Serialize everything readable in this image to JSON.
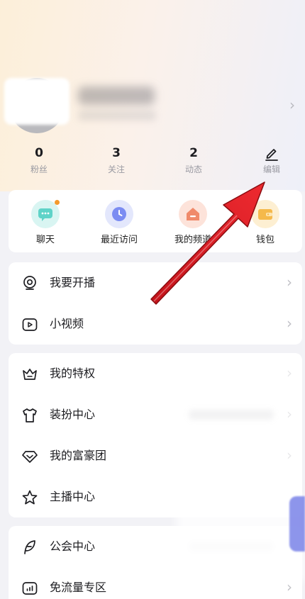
{
  "profile": {
    "stats": [
      {
        "value": "0",
        "label": "粉丝"
      },
      {
        "value": "3",
        "label": "关注"
      },
      {
        "value": "2",
        "label": "动态"
      }
    ],
    "edit_label": "编辑"
  },
  "quick_actions": [
    {
      "label": "聊天",
      "icon": "chat-icon",
      "color": "#5fd3c8"
    },
    {
      "label": "最近访问",
      "icon": "clock-icon",
      "color": "#7b8cf2"
    },
    {
      "label": "我的频道",
      "icon": "home-icon",
      "color": "#f08a6a"
    },
    {
      "label": "钱包",
      "icon": "wallet-icon",
      "color": "#f5b94b"
    }
  ],
  "menu_sections": [
    {
      "items": [
        "我要开播",
        "小视频"
      ]
    },
    {
      "items": [
        "我的特权",
        "装扮中心",
        "我的富豪团",
        "主播中心"
      ]
    },
    {
      "items": [
        "公会中心",
        "免流量专区"
      ]
    }
  ],
  "colors": {
    "annotation_arrow": "#e11b22",
    "badge_dot": "#f39a2d"
  }
}
